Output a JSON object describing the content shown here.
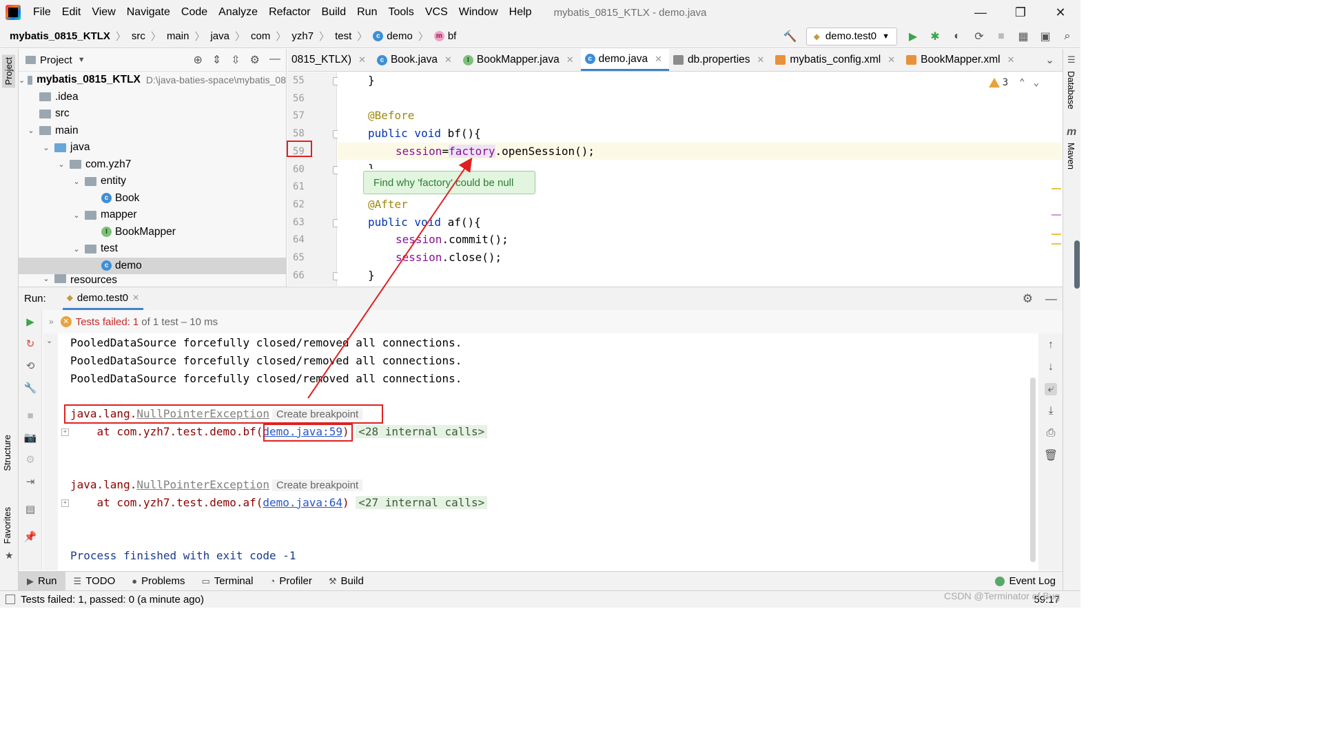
{
  "menubar": {
    "items": [
      "File",
      "Edit",
      "View",
      "Navigate",
      "Code",
      "Analyze",
      "Refactor",
      "Build",
      "Run",
      "Tools",
      "VCS",
      "Window",
      "Help"
    ],
    "title": "mybatis_0815_KTLX - demo.java",
    "minimize": "—",
    "restore": "❐",
    "close": "✕"
  },
  "breadcrumb": {
    "project": "mybatis_0815_KTLX",
    "parts": [
      "src",
      "main",
      "java",
      "com",
      "yzh7",
      "test"
    ],
    "class_badge": "c",
    "class_name": "demo",
    "method_badge": "m",
    "method_name": "bf"
  },
  "run_config": {
    "label": "demo.test0"
  },
  "left_stripe": {
    "project": "Project",
    "structure": "Structure",
    "favorites": "Favorites"
  },
  "right_stripe": {
    "database": "Database",
    "maven": "Maven",
    "maven_m": "m"
  },
  "project_panel": {
    "title": "Project",
    "tree": [
      {
        "label": "mybatis_0815_KTLX",
        "path": "D:\\java-baties-space\\mybatis_08"
      },
      {
        "label": ".idea"
      },
      {
        "label": "src"
      },
      {
        "label": "main"
      },
      {
        "label": "java"
      },
      {
        "label": "com.yzh7"
      },
      {
        "label": "entity"
      },
      {
        "label": "Book"
      },
      {
        "label": "mapper"
      },
      {
        "label": "BookMapper"
      },
      {
        "label": "test"
      },
      {
        "label": "demo"
      },
      {
        "label": "resources"
      }
    ],
    "badge_c": "c",
    "badge_i": "I"
  },
  "editor_tabs": [
    {
      "label": "0815_KTLX)"
    },
    {
      "label": "Book.java"
    },
    {
      "label": "BookMapper.java"
    },
    {
      "label": "demo.java"
    },
    {
      "label": "db.properties"
    },
    {
      "label": "mybatis_config.xml"
    },
    {
      "label": "BookMapper.xml"
    }
  ],
  "editor": {
    "warning_count": "3",
    "lines": [
      {
        "n": "55",
        "code": "}"
      },
      {
        "n": "56",
        "code": ""
      },
      {
        "n": "57",
        "code": "@Before"
      },
      {
        "n": "58",
        "code": "public void bf(){"
      },
      {
        "n": "59",
        "code": "session=factory.openSession();"
      },
      {
        "n": "60",
        "code": "}"
      },
      {
        "n": "61",
        "code": ""
      },
      {
        "n": "62",
        "code": "@After"
      },
      {
        "n": "63",
        "code": "public void af(){"
      },
      {
        "n": "64",
        "code": "session.commit();"
      },
      {
        "n": "65",
        "code": "session.close();"
      },
      {
        "n": "66",
        "code": "}"
      }
    ],
    "tooltip": "Find why 'factory' could be null"
  },
  "run_panel": {
    "label": "Run:",
    "tab": "demo.test0",
    "status_prefix": "Tests failed:",
    "status_count": "1",
    "status_suffix": "of 1 test – 10 ms",
    "console": {
      "pooled": "PooledDataSource forcefully closed/removed all connections.",
      "exc_pkg": "java.lang.",
      "exc_name": "NullPointerException",
      "create_bp": "Create breakpoint",
      "at1_prefix": "    at com.yzh7.test.demo.bf(",
      "at1_link": "demo.java:59",
      "at1_suffix": ")",
      "internal1": "<28 internal calls>",
      "at2_prefix": "    at com.yzh7.test.demo.af(",
      "at2_link": "demo.java:64",
      "at2_suffix": ")",
      "internal2": "<27 internal calls>",
      "exit": "Process finished with exit code -1"
    }
  },
  "bottom_tools": [
    {
      "label": "Run"
    },
    {
      "label": "TODO"
    },
    {
      "label": "Problems"
    },
    {
      "label": "Terminal"
    },
    {
      "label": "Profiler"
    },
    {
      "label": "Build"
    }
  ],
  "event_log": "Event Log",
  "statusbar": {
    "message": "Tests failed: 1, passed: 0 (a minute ago)",
    "position": "59:17"
  },
  "watermark": "CSDN @Terminator of Bug",
  "colors": {
    "keyword": "#0033b3",
    "annotation": "#9e880d",
    "field": "#871094",
    "exception": "#8b0000",
    "link": "#2a55c9",
    "annotation_red": "#e02020",
    "tab_accent": "#4083c9"
  }
}
